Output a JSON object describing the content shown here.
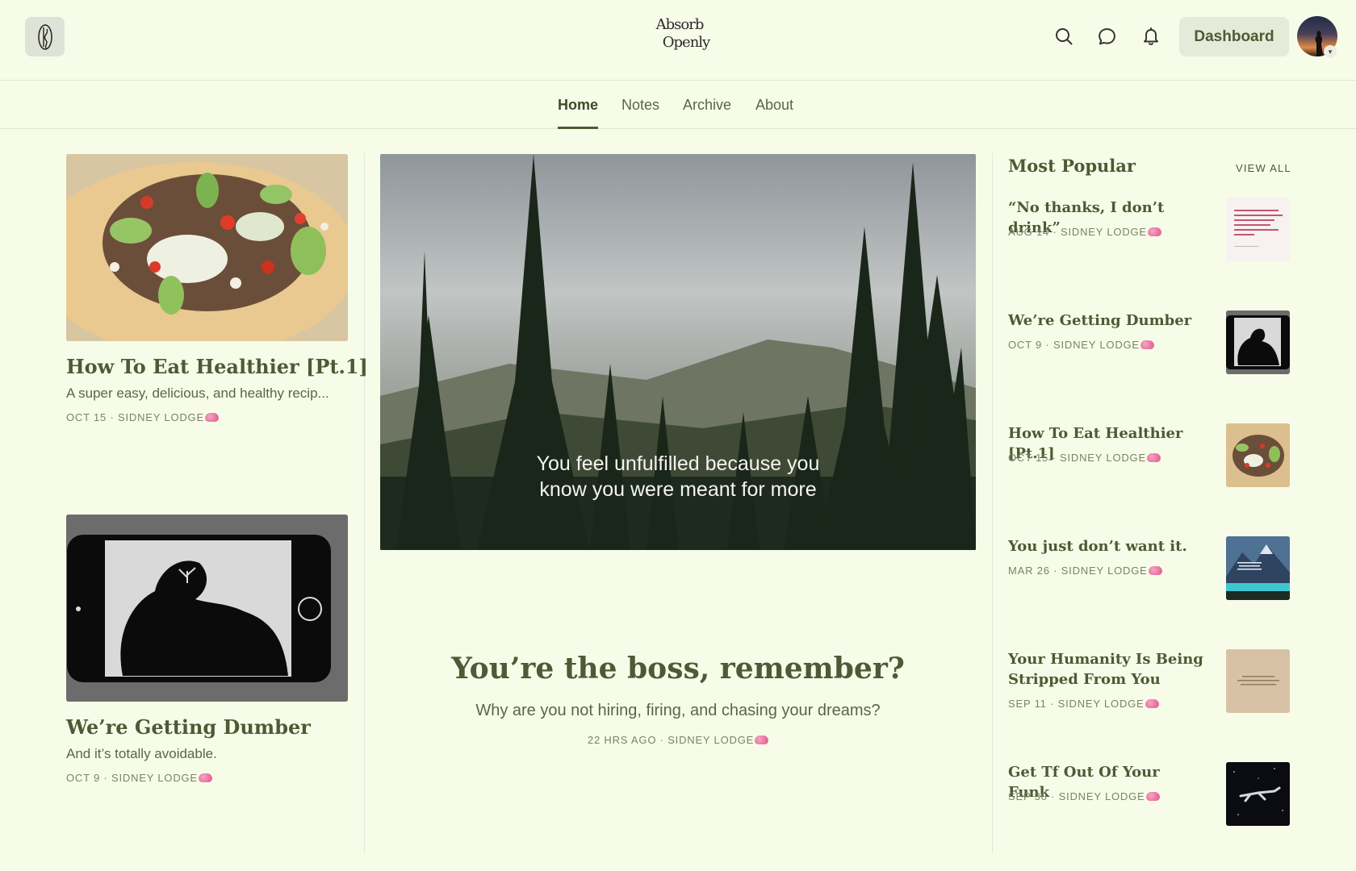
{
  "header": {
    "logo_mark": "A",
    "wordmark_line1": "Absorb",
    "wordmark_line2": "Openly",
    "dashboard_label": "Dashboard"
  },
  "nav": {
    "tabs": [
      {
        "label": "Home",
        "active": true
      },
      {
        "label": "Notes",
        "active": false
      },
      {
        "label": "Archive",
        "active": false
      },
      {
        "label": "About",
        "active": false
      }
    ]
  },
  "left_posts": [
    {
      "title": "How To Eat Healthier [Pt.1]",
      "subtitle": "A super easy, delicious, and healthy recip...",
      "meta": "OCT 15 · SIDNEY LODGE"
    },
    {
      "title": "We’re Getting Dumber",
      "subtitle": "And it’s totally avoidable.",
      "meta": "OCT 9 · SIDNEY LODGE"
    }
  ],
  "featured": {
    "image_caption_line1": "You feel unfulfilled because you",
    "image_caption_line2": "know you were meant for more",
    "title": "You’re the boss, remember?",
    "subtitle": "Why are you not hiring, firing, and chasing your dreams?",
    "meta": "22 HRS AGO · SIDNEY LODGE"
  },
  "popular": {
    "heading": "Most Popular",
    "view_all": "VIEW ALL",
    "items": [
      {
        "title": "“No thanks, I don’t drink”",
        "meta": "AUG 14 · SIDNEY LODGE"
      },
      {
        "title": "We’re Getting Dumber",
        "meta": "OCT 9 · SIDNEY LODGE"
      },
      {
        "title": "How To Eat Healthier [Pt.1]",
        "meta": "OCT 15 · SIDNEY LODGE"
      },
      {
        "title": "You just don’t want it.",
        "meta": "MAR 26 · SIDNEY LODGE"
      },
      {
        "title": "Your Humanity Is Being Stripped From You",
        "meta": "SEP 11 · SIDNEY LODGE"
      },
      {
        "title": "Get Tf Out Of Your Funk",
        "meta": "SEP 30 · SIDNEY LODGE"
      }
    ]
  },
  "colors": {
    "background": "#f7fce9",
    "accent": "#4d5a35",
    "meta_text": "#7a8266"
  },
  "icons": [
    "search-icon",
    "chat-icon",
    "bell-icon",
    "brain-emoji-icon"
  ]
}
